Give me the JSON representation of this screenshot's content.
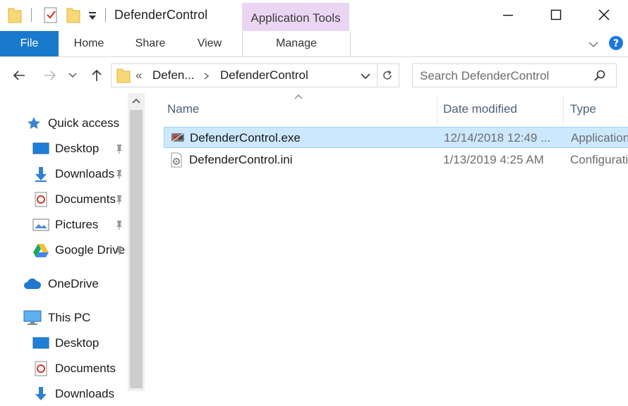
{
  "window": {
    "title": "DefenderControl",
    "context_tab": "Application Tools"
  },
  "ribbon": {
    "tabs": [
      "File",
      "Home",
      "Share",
      "View",
      "Manage"
    ]
  },
  "address": {
    "overflow": "«",
    "crumbs": [
      "Defen...",
      "DefenderControl"
    ],
    "search_placeholder": "Search DefenderControl"
  },
  "nav": {
    "quick_access": "Quick access",
    "quick_items": [
      "Desktop",
      "Downloads",
      "Documents",
      "Pictures",
      "Google Drive"
    ],
    "onedrive": "OneDrive",
    "this_pc": "This PC",
    "pc_items": [
      "Desktop",
      "Documents",
      "Downloads"
    ]
  },
  "columns": {
    "name": "Name",
    "date": "Date modified",
    "type": "Type"
  },
  "files": [
    {
      "name": "DefenderControl.exe",
      "date": "12/14/2018 12:49 ...",
      "type": "Application",
      "selected": true
    },
    {
      "name": "DefenderControl.ini",
      "date": "1/13/2019 4:25 AM",
      "type": "Configuration settings",
      "selected": false
    }
  ],
  "colors": {
    "accent": "#1979ca",
    "context_tab_bg": "#ead6f3",
    "selection_bg": "#cce8ff",
    "selection_border": "#99d1ff",
    "help_icon": "#1e78d7"
  },
  "icons": {
    "qa_folder": "folder-icon",
    "qa_properties": "properties-icon",
    "qa_new_folder": "new-folder-icon",
    "qa_customize": "dropdown-arrow-icon",
    "back": "back-arrow-icon",
    "forward": "forward-arrow-icon",
    "recent": "chevron-down-icon",
    "up": "up-arrow-icon",
    "refresh": "refresh-icon",
    "search": "search-icon",
    "help": "help-icon"
  }
}
